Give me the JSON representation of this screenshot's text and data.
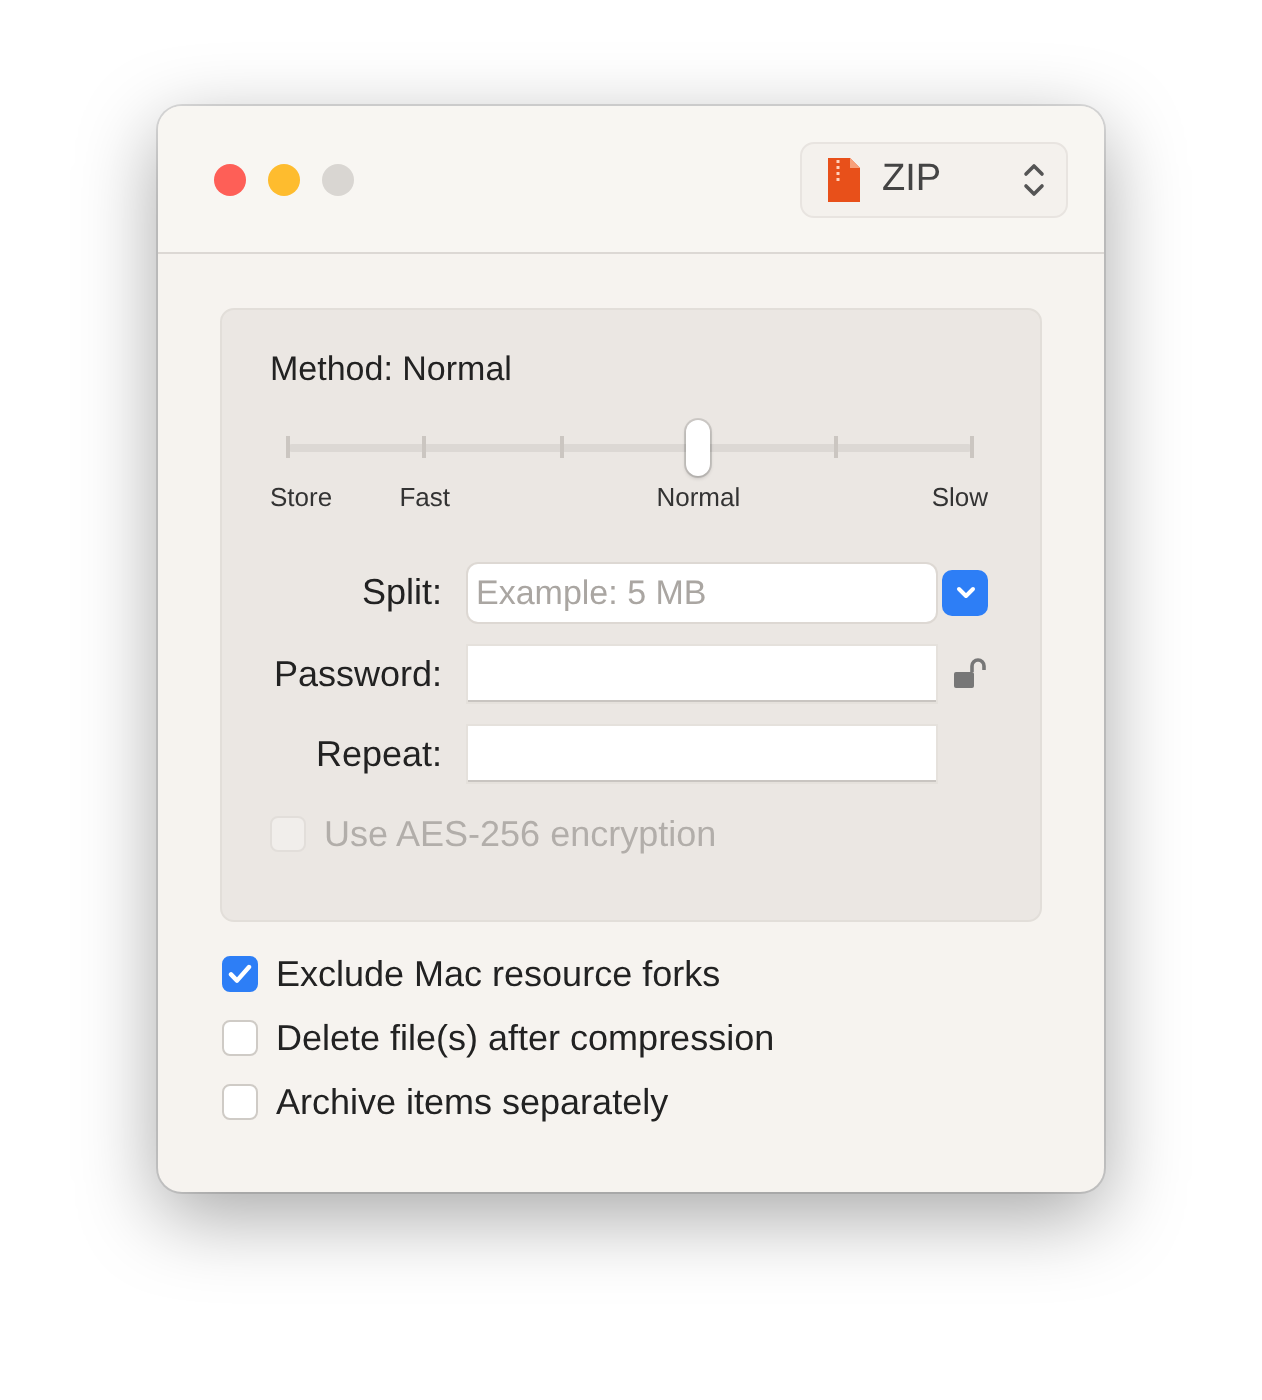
{
  "window": {
    "format_popup": {
      "label": "ZIP"
    }
  },
  "method": {
    "title": "Method: Normal",
    "level": 0.6,
    "ticks": [
      {
        "kind": "labeled",
        "label": "Store"
      },
      {
        "kind": "labeled",
        "label": "Fast"
      },
      {
        "kind": "plain"
      },
      {
        "kind": "labeled",
        "label": "Normal"
      },
      {
        "kind": "plain"
      },
      {
        "kind": "labeled",
        "label": "Slow"
      }
    ]
  },
  "fields": [
    {
      "label": "Split:",
      "kind": "combo",
      "placeholder": "Example: 5 MB"
    },
    {
      "label": "Password:",
      "kind": "secure"
    },
    {
      "label": "Repeat:",
      "kind": "plain"
    }
  ],
  "encryption": {
    "label": "Use AES-256 encryption",
    "checked": false,
    "disabled": true
  },
  "options": [
    {
      "label": "Exclude Mac resource forks",
      "checked": true,
      "disabled": false
    },
    {
      "label": "Delete file(s) after compression",
      "checked": false,
      "disabled": false
    },
    {
      "label": "Archive items separately",
      "checked": false,
      "disabled": false
    }
  ]
}
